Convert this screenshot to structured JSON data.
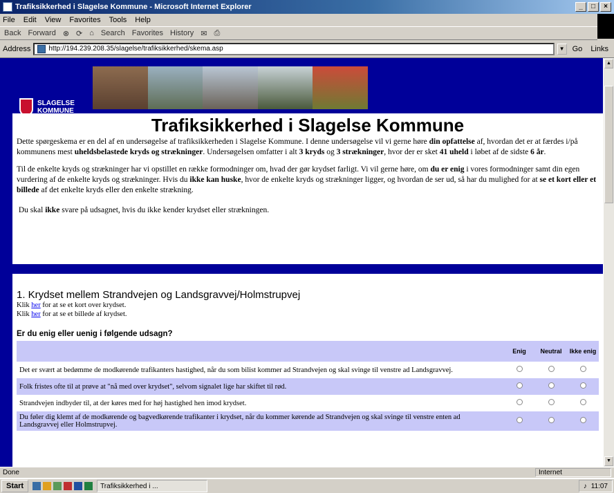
{
  "window": {
    "title": "Trafiksikkerhed i Slagelse Kommune - Microsoft Internet Explorer"
  },
  "menu": [
    "File",
    "Edit",
    "View",
    "Favorites",
    "Tools",
    "Help"
  ],
  "toolbar": {
    "back": "Back",
    "forward": "Forward",
    "search": "Search",
    "favorites": "Favorites",
    "history": "History"
  },
  "address": {
    "label": "Address",
    "url": "http://194.239.208.35/slagelse/trafiksikkerhed/skema.asp",
    "go": "Go",
    "links": "Links"
  },
  "logo": {
    "line1": "SLAGELSE",
    "line2": "KOMMUNE"
  },
  "page": {
    "title": "Trafiksikkerhed i Slagelse Kommune",
    "p1": {
      "a": "Dette spørgeskema er en del af en undersøgelse af trafiksikkerheden i Slagelse Kommune. I denne undersøgelse vil vi gerne høre ",
      "b": "din opfattelse",
      "c": " af, hvordan det er at færdes i/på kommunens mest ",
      "d": "uheldsbelastede kryds og strækninger",
      "e": ". Undersøgelsen omfatter i alt ",
      "f": "3 kryds",
      "g": " og ",
      "h": "3 strækninger",
      "i": ", hvor der er sket ",
      "j": "41 uheld",
      "k": " i løbet af de sidste ",
      "l": "6 år",
      "m": "."
    },
    "p2": {
      "a": "Til de enkelte kryds og strækninger har vi opstillet en række formodninger om, hvad der gør krydset farligt. Vi vil gerne høre, om ",
      "b": "du er enig",
      "c": " i vores formodninger samt din egen vurdering af de enkelte kryds og strækninger. Hvis du ",
      "d": "ikke kan huske",
      "e": ", hvor de enkelte kryds og strækninger ligger, og hvordan de ser ud, så har du mulighed for at ",
      "f": "se et kort eller et billede",
      "g": " af det enkelte kryds eller den enkelte strækning."
    },
    "p3": {
      "a": "Du skal ",
      "b": "ikke",
      "c": " svare på udsagnet, hvis du ikke kender krydset eller strækningen."
    }
  },
  "section": {
    "heading": "1. Krydset mellem Strandvejen og Landsgravvej/Holmstrupvej",
    "map_prefix": "Klik ",
    "map_link": "her",
    "map_suffix": " for at se et kort over krydset.",
    "photo_prefix": "Klik ",
    "photo_link": "her",
    "photo_suffix": " for at se et billede af krydset.",
    "question": "Er du enig eller uenig i følgende udsagn?",
    "columns": [
      "Enig",
      "Neutral",
      "Ikke enig"
    ],
    "statements": [
      "Det er svært at bedømme de modkørende trafikanters hastighed, når du som bilist kommer ad Strandvejen og skal svinge til venstre ad Landsgravvej.",
      "Folk fristes ofte til at prøve at \"nå med over krydset\", selvom signalet lige har skiftet til rød.",
      "Strandvejen indbyder til, at der køres med for høj hastighed hen imod krydset.",
      "Du føler dig klemt af de modkørende og bagvedkørende trafikanter i krydset, når du kommer kørende ad Strandvejen og skal svinge til venstre enten ad Landsgravvej eller Holmstrupvej."
    ]
  },
  "status": {
    "left": "Done",
    "zone": "Internet"
  },
  "taskbar": {
    "start": "Start",
    "task": "Trafiksikkerhed i ...",
    "clock": "11:07"
  }
}
